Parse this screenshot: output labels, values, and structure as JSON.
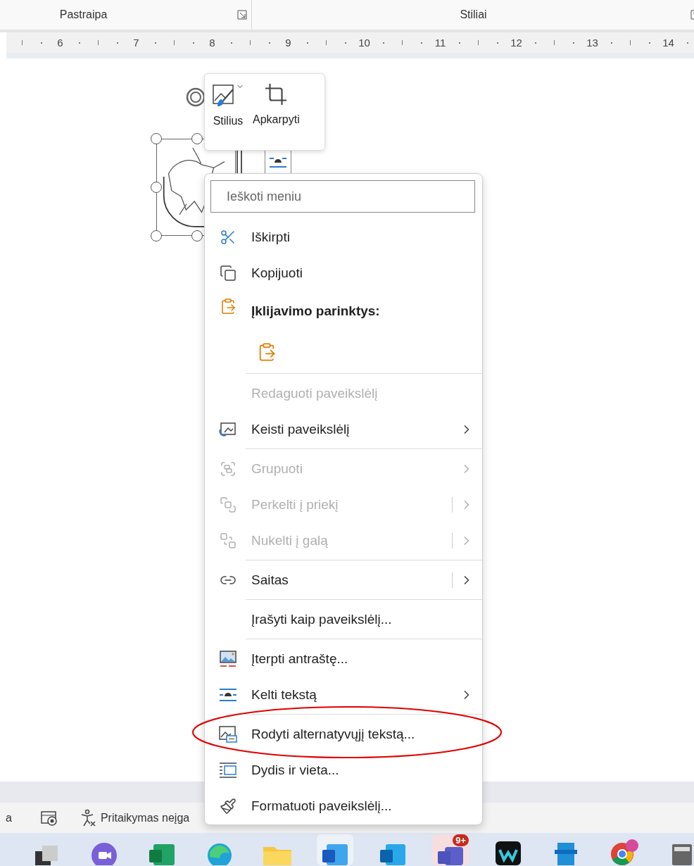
{
  "ribbon": {
    "groups": [
      {
        "label": "Pastraipa"
      },
      {
        "label": "Stiliai"
      }
    ]
  },
  "ruler": {
    "labels": [
      "6",
      "7",
      "8",
      "9",
      "10",
      "11",
      "12",
      "13",
      "14"
    ]
  },
  "mini_toolbar": {
    "buttons": [
      {
        "label": "Stilius"
      },
      {
        "label": "Apkarpyti"
      }
    ]
  },
  "context_menu": {
    "search": {
      "placeholder": "Ieškoti meniu"
    },
    "items": [
      {
        "kind": "item",
        "label": "Iškirpti",
        "disabled": false,
        "submenu": false,
        "split": false
      },
      {
        "kind": "item",
        "label": "Kopijuoti",
        "disabled": false,
        "submenu": false,
        "split": false
      },
      {
        "kind": "header",
        "label": "Įklijavimo parinktys:"
      },
      {
        "kind": "paste_options"
      },
      {
        "kind": "separator"
      },
      {
        "kind": "item",
        "label": "Redaguoti paveikslėlį",
        "disabled": true,
        "submenu": false,
        "split": false
      },
      {
        "kind": "item",
        "label": "Keisti paveikslėlį",
        "disabled": false,
        "submenu": true,
        "split": false
      },
      {
        "kind": "separator"
      },
      {
        "kind": "item",
        "label": "Grupuoti",
        "disabled": true,
        "submenu": true,
        "split": false
      },
      {
        "kind": "item",
        "label": "Perkelti į priekį",
        "disabled": true,
        "submenu": true,
        "split": true
      },
      {
        "kind": "item",
        "label": "Nukelti į galą",
        "disabled": true,
        "submenu": true,
        "split": true
      },
      {
        "kind": "separator"
      },
      {
        "kind": "item",
        "label": "Saitas",
        "disabled": false,
        "submenu": true,
        "split": true
      },
      {
        "kind": "separator"
      },
      {
        "kind": "item",
        "label": "Įrašyti kaip paveikslėlį...",
        "disabled": false,
        "submenu": false,
        "split": false
      },
      {
        "kind": "separator"
      },
      {
        "kind": "item",
        "label": "Įterpti antraštę...",
        "disabled": false,
        "submenu": false,
        "split": false
      },
      {
        "kind": "item",
        "label": "Kelti tekstą",
        "disabled": false,
        "submenu": true,
        "split": false
      },
      {
        "kind": "separator"
      },
      {
        "kind": "item",
        "label": "Rodyti alternatyvųjį tekstą...",
        "disabled": false,
        "submenu": false,
        "split": false
      },
      {
        "kind": "item",
        "label": "Dydis ir vieta...",
        "disabled": false,
        "submenu": false,
        "split": false
      },
      {
        "kind": "item",
        "label": "Formatuoti paveikslėlį...",
        "disabled": false,
        "submenu": false,
        "split": false
      }
    ]
  },
  "status_bar": {
    "items": [
      {
        "label": "a"
      },
      {
        "label": "Pritaikymas neįga"
      }
    ]
  },
  "taskbar": {
    "badge": "9+"
  }
}
